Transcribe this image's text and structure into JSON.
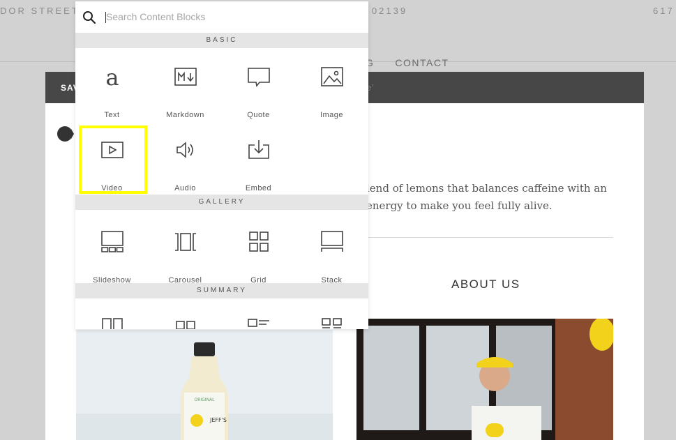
{
  "site": {
    "address_left": "DOR STREET",
    "address_mid": "A, 02139",
    "phone_partial": "617",
    "nav_partial": "G",
    "nav_contact": "CONTACT"
  },
  "editor": {
    "save_label": "SAV",
    "bar_hint": "e'",
    "body_line1": "lend of lemons that balances caffeine with an",
    "body_line2": "energy to make you feel fully alive.",
    "about_heading": "ABOUT US"
  },
  "picker": {
    "search_placeholder": "Search Content Blocks",
    "sections": {
      "basic": "BASIC",
      "gallery": "GALLERY",
      "summary": "SUMMARY"
    },
    "basic": [
      {
        "label": "Text",
        "icon": "text-icon"
      },
      {
        "label": "Markdown",
        "icon": "markdown-icon"
      },
      {
        "label": "Quote",
        "icon": "quote-icon"
      },
      {
        "label": "Image",
        "icon": "image-icon"
      },
      {
        "label": "Video",
        "icon": "video-icon"
      },
      {
        "label": "Audio",
        "icon": "audio-icon"
      },
      {
        "label": "Embed",
        "icon": "embed-icon"
      }
    ],
    "gallery": [
      {
        "label": "Slideshow",
        "icon": "slideshow-icon"
      },
      {
        "label": "Carousel",
        "icon": "carousel-icon"
      },
      {
        "label": "Grid",
        "icon": "grid-icon"
      },
      {
        "label": "Stack",
        "icon": "stack-icon"
      }
    ],
    "highlight_color": "#ffff00"
  },
  "colors": {
    "editor_bar": "#474747",
    "section_header": "#e5e5e5",
    "background": "#d2d2d2"
  }
}
